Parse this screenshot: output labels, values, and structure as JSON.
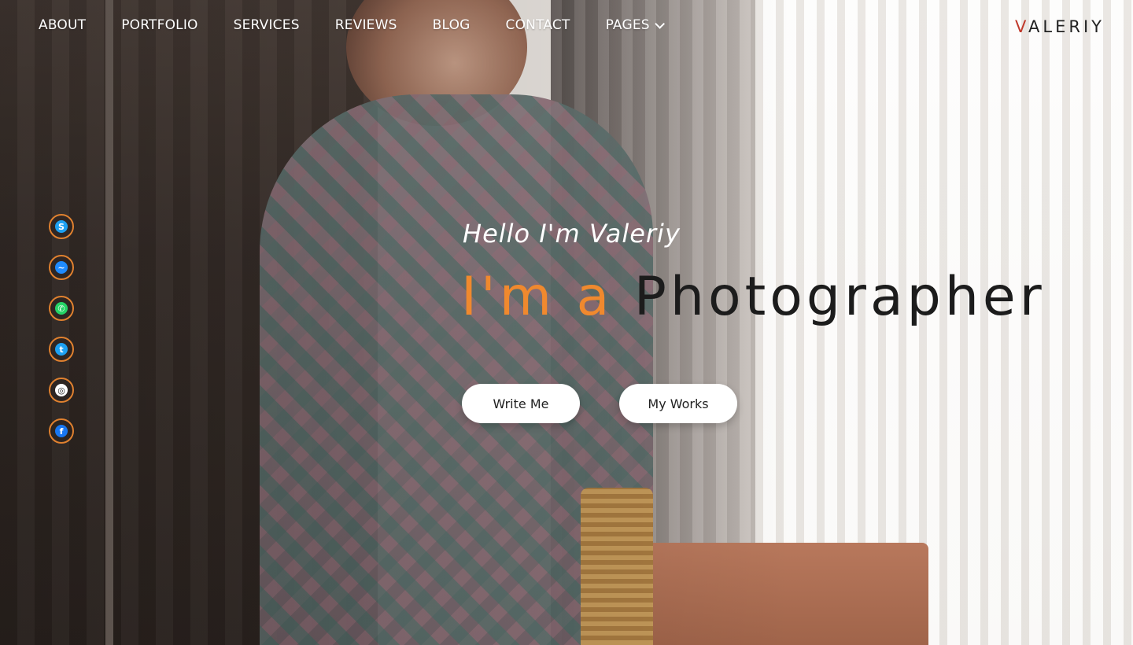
{
  "nav": {
    "items": [
      {
        "label": "ABOUT"
      },
      {
        "label": "PORTFOLIO"
      },
      {
        "label": "SERVICES"
      },
      {
        "label": "REVIEWS"
      },
      {
        "label": "BLOG"
      },
      {
        "label": "CONTACT"
      },
      {
        "label": "PAGES",
        "has_dropdown": true
      }
    ]
  },
  "logo": {
    "first": "V",
    "rest": "ALERIY"
  },
  "social": [
    {
      "icon": "skype-icon",
      "glyph": "S",
      "color": "#1ea1f1"
    },
    {
      "icon": "messenger-icon",
      "glyph": "~",
      "color": "#1f8bff"
    },
    {
      "icon": "whatsapp-icon",
      "glyph": "✆",
      "color": "#25d366"
    },
    {
      "icon": "twitter-icon",
      "glyph": "t",
      "color": "#1da1f2"
    },
    {
      "icon": "instagram-icon",
      "glyph": "◎",
      "color": "#ffffff"
    },
    {
      "icon": "facebook-icon",
      "glyph": "f",
      "color": "#1877f2"
    }
  ],
  "hero": {
    "greeting": "Hello I'm Valeriy",
    "headline_accent": "I'm a ",
    "headline_main": "Photographer",
    "accent_color": "#f0892e"
  },
  "buttons": {
    "write": "Write Me",
    "works": "My Works"
  }
}
